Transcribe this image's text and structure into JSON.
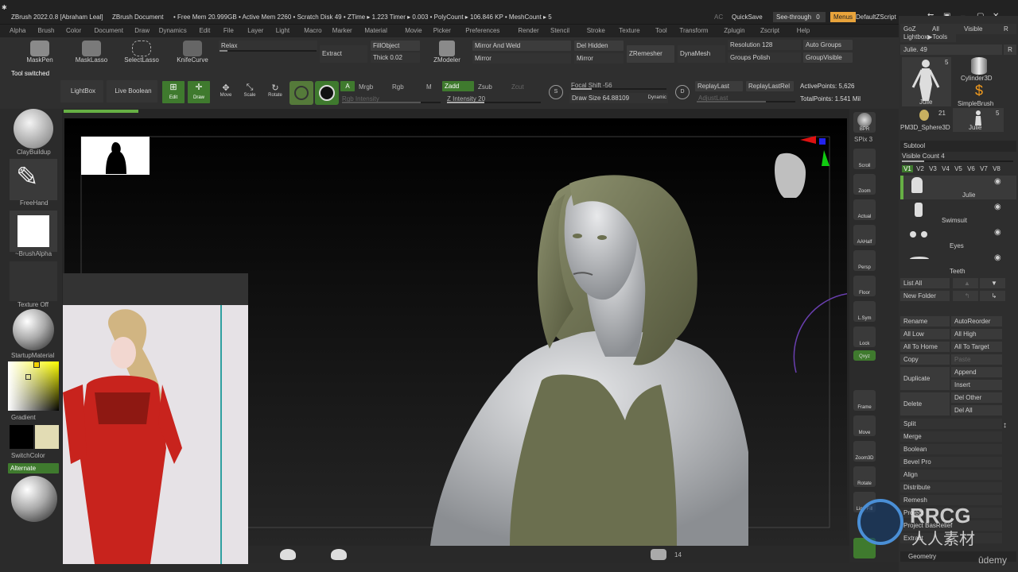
{
  "titlebar": {
    "app": "ZBrush 2022.0.8 [Abraham Leal]",
    "doc": "ZBrush Document",
    "stats": "• Free Mem 20.999GB • Active Mem 2260 • Scratch Disk 49 • ZTime ▸ 1.223 Timer ▸ 0.003 • PolyCount ▸ 106.846 KP • MeshCount ▸ 5",
    "ac": "AC",
    "quicksave": "QuickSave",
    "seethrough": "See-through",
    "seethrough_val": "0",
    "menus": "Menus",
    "script": "DefaultZScript"
  },
  "menubar": [
    "Alpha",
    "Brush",
    "Color",
    "Document",
    "Draw",
    "Dynamics",
    "Edit",
    "File",
    "Layer",
    "Light",
    "Macro",
    "Marker",
    "Material",
    "Movie",
    "Picker",
    "Preferences",
    "Render",
    "Stencil",
    "Stroke",
    "Texture",
    "Tool",
    "Transform",
    "Zplugin",
    "Zscript",
    "Help"
  ],
  "shelf": {
    "maskpen": "MaskPen",
    "masklasso": "MaskLasso",
    "selectlasso": "SelectLasso",
    "knifecurve": "KnifeCurve",
    "relax": "Relax",
    "extract": "Extract",
    "fillobject": "FillObject",
    "thick": "Thick 0.02",
    "zmodeler": "ZModeler",
    "mirror_weld": "Mirror And Weld",
    "mirror": "Mirror",
    "del_hidden": "Del Hidden",
    "zremesher": "ZRemesher",
    "dynamesh": "DynaMesh",
    "resolution": "Resolution 128",
    "groups_polish": "Groups  Polish",
    "auto_groups": "Auto Groups",
    "group_visible": "GroupVisible",
    "tool_switched": "Tool switched",
    "lightbox": "LightBox",
    "live_boolean": "Live Boolean",
    "edit": "Edit",
    "draw": "Draw",
    "move": "Move",
    "scale": "Scale",
    "rotate": "Rotate",
    "a": "A",
    "mrgb": "Mrgb",
    "rgb": "Rgb",
    "m": "M",
    "rgb_intensity": "Rgb Intensity",
    "zadd": "Zadd",
    "zsub": "Zsub",
    "zcut": "Zcut",
    "z_intensity": "Z Intensity 20",
    "focal_shift": "Focal Shift -56",
    "draw_size": "Draw Size 64.88109",
    "dynamic": "Dynamic",
    "replay_last": "ReplayLast",
    "replay_last_rel": "ReplayLastRel",
    "adjust_last": "AdjustLast",
    "active_points": "ActivePoints: 5,626",
    "total_points": "TotalPoints: 1.541 Mil",
    "s_label": "S",
    "d_label": "D"
  },
  "left": {
    "brush": "ClayBuildup",
    "stroke": "FreeHand",
    "alpha": "~BrushAlpha",
    "texture": "Texture Off",
    "material": "StartupMaterial",
    "gradient": "Gradient",
    "switchcolor": "SwitchColor",
    "alternate": "Alternate"
  },
  "righttools": [
    "BPR",
    "SPix 3",
    "Scroll",
    "Zoom",
    "Actual",
    "AAHalf",
    "Persp",
    "Floor",
    "L.Sym",
    "Lock",
    "Qxyz",
    "Frame",
    "Move",
    "Zoom3D",
    "Rotate",
    "Line Fill"
  ],
  "rightpanel": {
    "top_items": [
      "GoZ",
      "All",
      "Visible",
      "R"
    ],
    "lightbox_tools": "Lightbox▶Tools",
    "current_tool": "Julie. 49",
    "r": "R",
    "thumbs": [
      {
        "name": "Julie",
        "count": "5"
      },
      {
        "name": "Cylinder3D",
        "count": ""
      },
      {
        "name": "SimpleBrush",
        "count": ""
      },
      {
        "name": "PM3D_Sphere3D",
        "count": "21"
      },
      {
        "name": "Julie",
        "count": "5"
      }
    ],
    "subtool": "Subtool",
    "visible_count": "Visible Count 4",
    "versions": [
      "V1",
      "V2",
      "V3",
      "V4",
      "V5",
      "V6",
      "V7",
      "V8"
    ],
    "subtools": [
      "Julie",
      "Swimsuit",
      "Eyes",
      "Teeth"
    ],
    "list_all": "List All",
    "new_folder": "New Folder",
    "rename": "Rename",
    "auto_reorder": "AutoReorder",
    "all_low": "All Low",
    "all_high": "All High",
    "all_to_home": "All To Home",
    "all_to_target": "All To Target",
    "copy": "Copy",
    "paste": "Paste",
    "duplicate": "Duplicate",
    "append": "Append",
    "insert": "Insert",
    "delete": "Delete",
    "del_other": "Del Other",
    "del_all": "Del All",
    "split": "Split",
    "merge": "Merge",
    "boolean": "Boolean",
    "bevel_pro": "Bevel Pro",
    "align": "Align",
    "distribute": "Distribute",
    "remesh": "Remesh",
    "project": "Project",
    "project_bas": "Project BasRelief",
    "extract": "Extract",
    "geometry": "Geometry"
  },
  "bottom": {
    "count": "14"
  },
  "watermark": {
    "brand": "RRCG",
    "sub": "人人素材",
    "udemy": "ûdemy"
  },
  "colors": {
    "accent_orange": "#e8a33b",
    "accent_green": "#3f7a2e",
    "skin": "#c9cbcf",
    "cloth": "#6b6f4f",
    "armor_red": "#c8231d"
  }
}
